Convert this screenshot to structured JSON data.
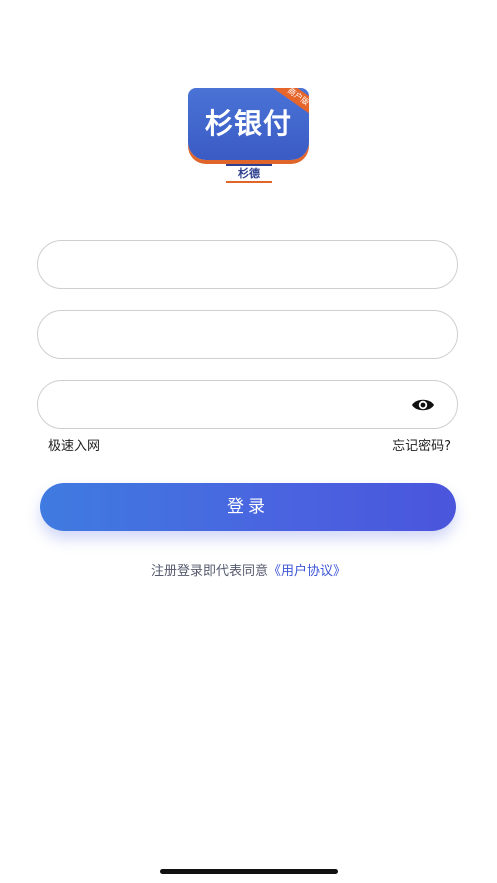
{
  "logo": {
    "title": "杉银付",
    "badge": "商户版",
    "subtitle": "杉德"
  },
  "form": {
    "field1": {
      "value": "",
      "placeholder": ""
    },
    "field2": {
      "value": "",
      "placeholder": ""
    },
    "field3": {
      "value": "",
      "placeholder": "",
      "toggle_icon": "eye-icon"
    }
  },
  "links": {
    "left": "极速入网",
    "right": "忘记密码?"
  },
  "login_button": "登录",
  "agreement": {
    "text": "注册登录即代表同意",
    "link": "《用户协议》"
  },
  "colors": {
    "accent": "#4a63e0",
    "link": "#3d55d6",
    "logo_blue": "#3a5bc4",
    "logo_orange": "#e0652a"
  }
}
